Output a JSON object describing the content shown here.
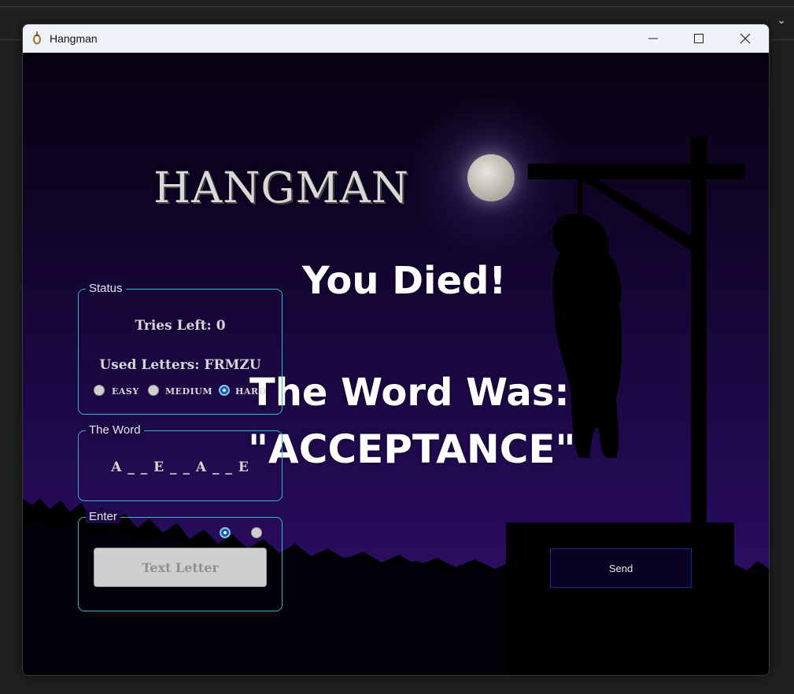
{
  "window": {
    "title": "Hangman"
  },
  "logo": {
    "text": "HANGMAN"
  },
  "message": {
    "line1": "You Died!",
    "line2": "The Word Was:",
    "line3": "\"ACCEPTANCE\""
  },
  "status": {
    "title": "Status",
    "tries_left": "Tries Left: 0",
    "used_letters": "Used Letters: FRMZU",
    "difficulty": [
      {
        "label": "EASY",
        "checked": false
      },
      {
        "label": "MEDIUM",
        "checked": false
      },
      {
        "label": "HARD",
        "checked": true
      }
    ]
  },
  "word_box": {
    "title": "The Word",
    "masked_word": "A _ _ E _ _ A _ _ E"
  },
  "enter": {
    "title": "Enter",
    "mode_radios": [
      {
        "checked": true
      },
      {
        "checked": false
      }
    ],
    "text_letter_label": "Text Letter"
  },
  "send_label": "Send",
  "colors": {
    "group_border": "#35b7c9",
    "radio_selected": "#0e5fb0",
    "send_border": "#1a2a8a"
  }
}
